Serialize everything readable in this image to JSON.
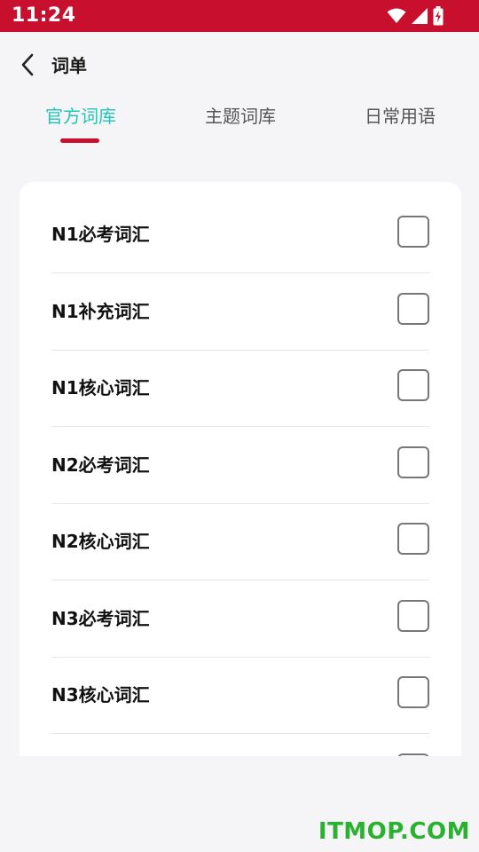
{
  "status_bar": {
    "time": "11:24",
    "icons": [
      "wifi-icon",
      "cell-signal-icon",
      "battery-charging-icon"
    ]
  },
  "header": {
    "back_icon": "chevron-left-icon",
    "title": "词单"
  },
  "tabs": [
    {
      "label": "官方词库",
      "active": true
    },
    {
      "label": "主题词库",
      "active": false
    },
    {
      "label": "日常用语",
      "active": false
    }
  ],
  "list": {
    "items": [
      {
        "label": "N1必考词汇",
        "checked": false
      },
      {
        "label": "N1补充词汇",
        "checked": false
      },
      {
        "label": "N1核心词汇",
        "checked": false
      },
      {
        "label": "N2必考词汇",
        "checked": false
      },
      {
        "label": "N2核心词汇",
        "checked": false
      },
      {
        "label": "N3必考词汇",
        "checked": false
      },
      {
        "label": "N3核心词汇",
        "checked": false
      }
    ]
  },
  "watermark": "ITMOP.COM",
  "colors": {
    "status_bar": "#c8102e",
    "accent": "#1fc5b8",
    "indicator": "#c8102e",
    "watermark": "#2ab12f"
  }
}
